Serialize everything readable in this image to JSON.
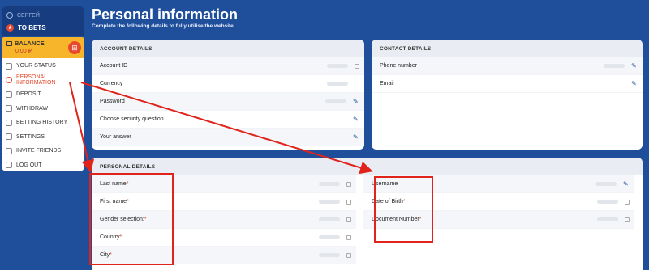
{
  "sidebar": {
    "user": "СЕРГЕЙ",
    "to_bets": "TO BETS",
    "balance_label": "BALANCE",
    "balance_amount": "0,00 ₽",
    "menu": [
      {
        "label": "YOUR STATUS"
      },
      {
        "label": "PERSONAL INFORMATION"
      },
      {
        "label": "DEPOSIT"
      },
      {
        "label": "WITHDRAW"
      },
      {
        "label": "BETTING HISTORY"
      },
      {
        "label": "SETTINGS"
      },
      {
        "label": "INVITE FRIENDS"
      },
      {
        "label": "LOG OUT"
      }
    ]
  },
  "header": {
    "title": "Personal information",
    "subtitle": "Complete the following details to fully utilise the website."
  },
  "account": {
    "heading": "ACCOUNT DETAILS",
    "rows": [
      "Account ID",
      "Currency",
      "Password",
      "Choose security question",
      "Your answer"
    ]
  },
  "contact": {
    "heading": "CONTACT DETAILS",
    "rows": [
      "Phone number",
      "Email"
    ]
  },
  "personal": {
    "heading": "PERSONAL DETAILS",
    "left": [
      "Last name",
      "First name",
      "Gender selection:",
      "Country",
      "City"
    ],
    "right": [
      "Username",
      "Date of Birth",
      "Document Number"
    ],
    "required_mark": "*"
  },
  "colors": {
    "accent": "#e8492e",
    "brand": "#1f4e9b",
    "balance": "#f6b52b"
  }
}
